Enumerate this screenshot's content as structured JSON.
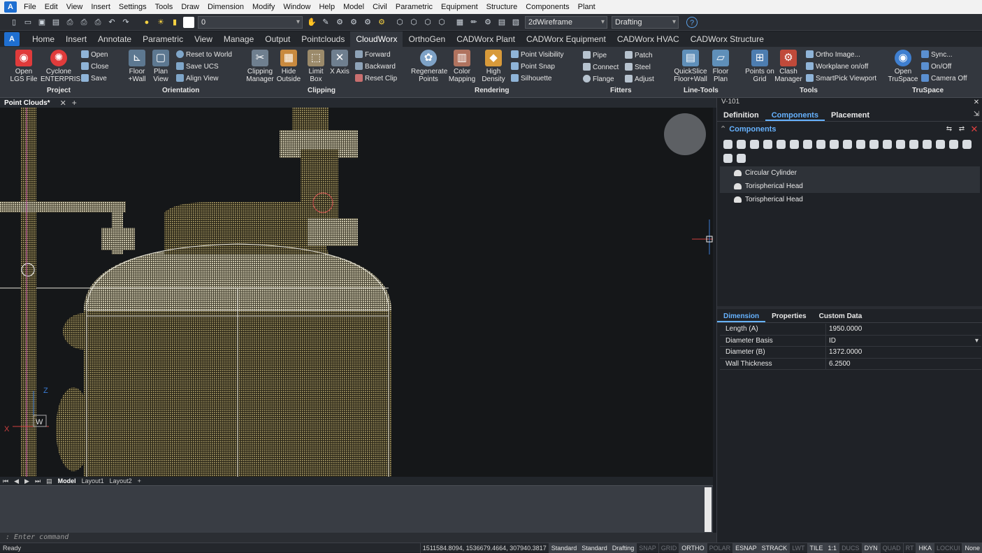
{
  "menubar": {
    "items": [
      "File",
      "Edit",
      "View",
      "Insert",
      "Settings",
      "Tools",
      "Draw",
      "Dimension",
      "Modify",
      "Window",
      "Help",
      "Model",
      "Civil",
      "Parametric",
      "Equipment",
      "Structure",
      "Components",
      "Plant"
    ]
  },
  "toolbar": {
    "layer_value": "0",
    "visual_style": "2dWireframe",
    "workspace": "Drafting"
  },
  "ribbon_tabs": [
    "Home",
    "Insert",
    "Annotate",
    "Parametric",
    "View",
    "Manage",
    "Output",
    "Pointclouds",
    "CloudWorx",
    "OrthoGen",
    "CADWorx Plant",
    "CADWorx Equipment",
    "CADWorx HVAC",
    "CADWorx Structure"
  ],
  "ribbon_active": "CloudWorx",
  "ribbon": {
    "project": {
      "label": "Project",
      "open_lgs": "Open LGS File",
      "cyclone": "Cyclone ENTERPRISE",
      "open": "Open",
      "close": "Close",
      "save": "Save"
    },
    "orientation": {
      "label": "Orientation",
      "floor_wall": "Floor +Wall",
      "plan_view": "Plan View",
      "reset_world": "Reset to World",
      "save_ucs": "Save UCS",
      "align_view": "Align View"
    },
    "clipping": {
      "label": "Clipping",
      "manager": "Clipping Manager",
      "hide_outside": "Hide Outside",
      "limit_box": "Limit Box",
      "x_axis": "X Axis",
      "forward": "Forward",
      "backward": "Backward",
      "reset_clip": "Reset Clip"
    },
    "rendering": {
      "label": "Rendering",
      "regenerate": "Regenerate Points",
      "color_mapping": "Color Mapping",
      "high_density": "High Density",
      "point_visibility": "Point Visibility",
      "point_snap": "Point Snap",
      "silhouette": "Silhouette"
    },
    "fitters": {
      "label": "Fitters",
      "pipe": "Pipe",
      "connect": "Connect",
      "flange": "Flange",
      "patch": "Patch",
      "steel": "Steel",
      "adjust": "Adjust"
    },
    "line_tools": {
      "label": "Line-Tools",
      "quickslice": "QuickSlice Floor+Wall",
      "floor_plan": "Floor Plan"
    },
    "tools": {
      "label": "Tools",
      "points_on_grid": "Points on Grid",
      "clash_manager": "Clash Manager",
      "ortho_image": "Ortho Image...",
      "workplane": "Workplane on/off",
      "smartpick": "SmartPick Viewport"
    },
    "truspace": {
      "label": "TruSpace",
      "open_truspace": "Open TruSpace",
      "sync": "Sync...",
      "onoff": "On/Off",
      "camera_off": "Camera Off"
    }
  },
  "doc_tab": "Point Clouds*",
  "layout_tabs": [
    "Model",
    "Layout1",
    "Layout2"
  ],
  "axes": {
    "z": "Z",
    "x": "X",
    "w": "W"
  },
  "command": {
    "prompt": "Enter command"
  },
  "status": {
    "ready": "Ready",
    "coords": "1511584.8094, 1536679.4664, 307940.3817",
    "items": [
      {
        "t": "Standard",
        "on": true
      },
      {
        "t": "Standard",
        "on": true
      },
      {
        "t": "Drafting",
        "on": true
      },
      {
        "t": "SNAP",
        "on": false
      },
      {
        "t": "GRID",
        "on": false
      },
      {
        "t": "ORTHO",
        "on": true
      },
      {
        "t": "POLAR",
        "on": false
      },
      {
        "t": "ESNAP",
        "on": true
      },
      {
        "t": "STRACK",
        "on": true
      },
      {
        "t": "LWT",
        "on": false
      },
      {
        "t": "TILE",
        "on": true
      },
      {
        "t": "1:1",
        "on": true
      },
      {
        "t": "DUCS",
        "on": false
      },
      {
        "t": "DYN",
        "on": true
      },
      {
        "t": "QUAD",
        "on": false
      },
      {
        "t": "RT",
        "on": false
      },
      {
        "t": "HKA",
        "on": true
      },
      {
        "t": "LOCKUI",
        "on": false
      },
      {
        "t": "None",
        "on": true
      }
    ]
  },
  "panel": {
    "title": "V-101",
    "tabs": [
      "Definition",
      "Components",
      "Placement"
    ],
    "active_tab": "Components",
    "components_header": "Components",
    "components": [
      {
        "name": "Circular Cylinder",
        "selected": true
      },
      {
        "name": "Torispherical Head",
        "selected": true
      },
      {
        "name": "Torispherical Head",
        "selected": false
      }
    ],
    "dim_tabs": [
      "Dimension",
      "Properties",
      "Custom Data"
    ],
    "dim_active": "Dimension",
    "dims": [
      {
        "k": "Length (A)",
        "v": "1950.0000"
      },
      {
        "k": "Diameter Basis",
        "v": "ID",
        "select": true
      },
      {
        "k": "Diameter (B)",
        "v": "1372.0000"
      },
      {
        "k": "Wall Thickness",
        "v": "6.2500"
      }
    ]
  }
}
